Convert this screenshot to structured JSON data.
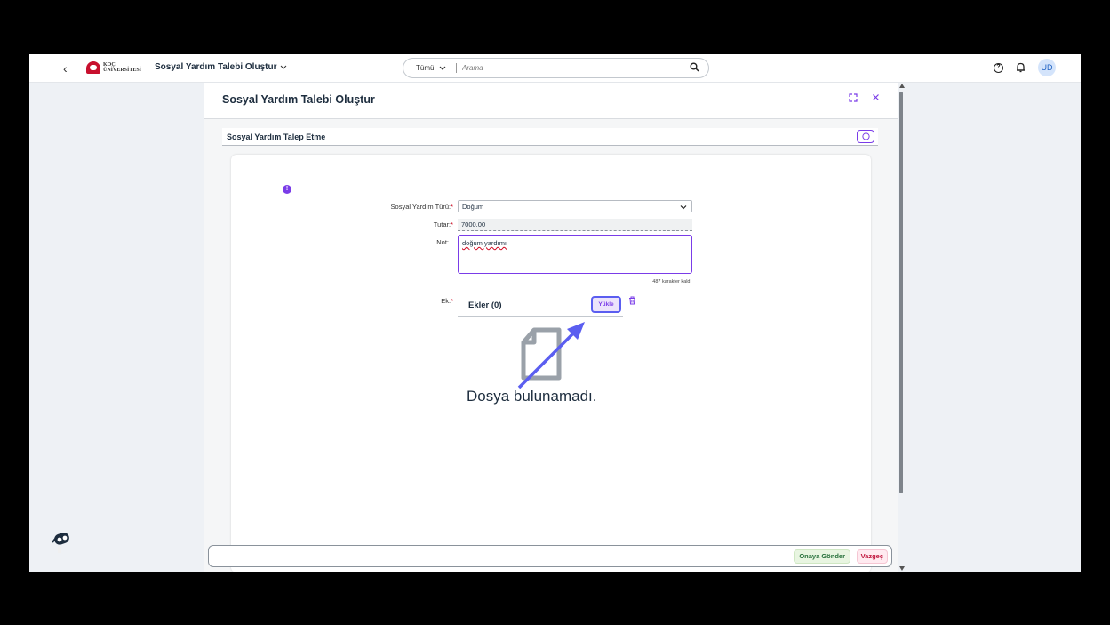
{
  "shell": {
    "back_glyph": "‹",
    "logo_line1": "KOÇ",
    "logo_line2": "ÜNİVERSİTESİ",
    "app_title": "Sosyal Yardım Talebi Oluştur",
    "search_scope": "Tümü",
    "search_placeholder": "Arama",
    "avatar_initials": "UD"
  },
  "dialog": {
    "title": "Sosyal Yardım Talebi Oluştur",
    "section_title": "Sosyal Yardım Talep Etme",
    "form": {
      "type_label": "Sosyal Yardım Türü:",
      "type_value": "Doğum",
      "amount_label": "Tutar:",
      "amount_value": "7000.00",
      "note_label": "Not:",
      "note_value": "doğum yardımı",
      "counter": "487 karakter kaldı",
      "attachment_label": "Ek:",
      "attachments_title": "Ekler (0)",
      "upload_label": "Yükle",
      "empty_text": "Dosya bulunamadı."
    },
    "footer": {
      "submit_label": "Onaya Gönder",
      "cancel_label": "Vazgeç"
    }
  },
  "colors": {
    "accent": "#7a3ce8",
    "annotation_arrow": "#5b5ef0"
  }
}
